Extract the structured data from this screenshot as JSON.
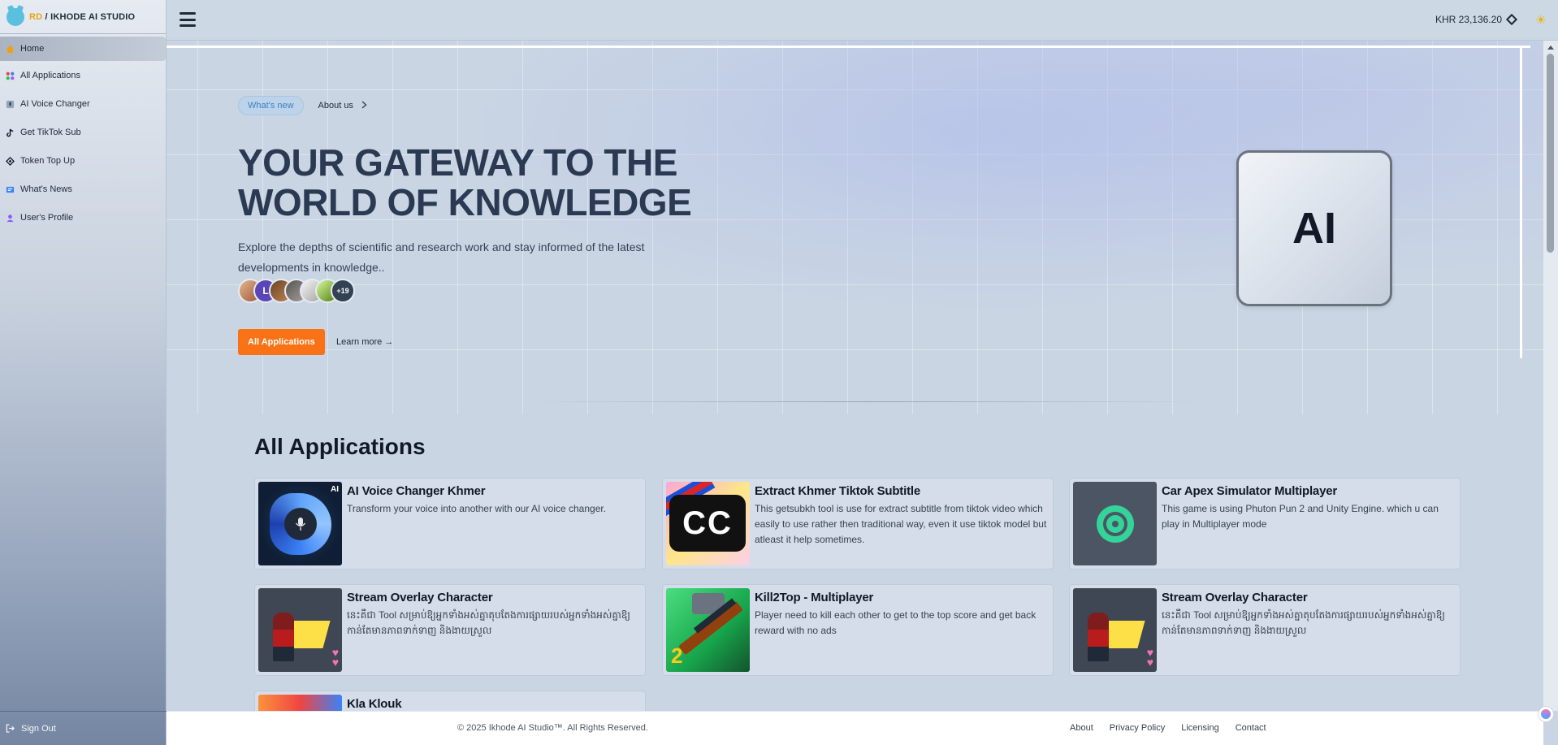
{
  "brand": {
    "prefix": "RD",
    "name": " / IKHODE AI STUDIO"
  },
  "sidebar": {
    "items": [
      {
        "label": "Home",
        "icon": "home-icon"
      },
      {
        "label": "All Applications",
        "icon": "apps-icon"
      },
      {
        "label": "AI Voice Changer",
        "icon": "voice-icon"
      },
      {
        "label": "Get TikTok Sub",
        "icon": "tiktok-icon"
      },
      {
        "label": "Token Top Up",
        "icon": "token-icon"
      },
      {
        "label": "What's News",
        "icon": "news-icon"
      },
      {
        "label": "User's Profile",
        "icon": "profile-icon"
      }
    ],
    "signout": "Sign Out"
  },
  "topbar": {
    "balance": "KHR 23,136.20"
  },
  "hero": {
    "pill": "What's new",
    "about": "About us",
    "title": "YOUR GATEWAY TO THE WORLD OF KNOWLEDGE",
    "subtitle": "Explore the depths of scientific and research work and stay informed of the latest developments in knowledge..",
    "avatar_more": "+19",
    "avatar_letter": "L",
    "cta": "All Applications",
    "learn_more": "Learn more →",
    "ai_badge": "AI"
  },
  "apps": {
    "title": "All Applications",
    "items": [
      {
        "title": "AI Voice Changer Khmer",
        "desc": "Transform your voice into another with our AI voice changer.",
        "thumb_label": "AI"
      },
      {
        "title": "Extract Khmer Tiktok Subtitle",
        "desc": "This getsubkh tool is use for extract subtitle from tiktok video which easily to use rather then traditional way, even it use tiktok model but atleast it help sometimes.",
        "thumb_label": "CC"
      },
      {
        "title": "Car Apex Simulator Multiplayer",
        "desc": "This game is using Phuton Pun 2 and Unity Engine. which u can play in Multiplayer mode"
      },
      {
        "title": "Stream Overlay Character",
        "desc": "នេះគឺជា Tool សម្រាប់ឱ្យអ្នកទាំងអស់គ្នាតុបតែងការផ្សាយរបស់អ្នកទាំងអស់គ្នាឱ្យកាន់តែមានភាពទាក់ទាញ និងងាយស្រួល"
      },
      {
        "title": "Kill2Top - Multiplayer",
        "desc": "Player need to kill each other to get to the top score and get back reward with no ads",
        "thumb_label": "2"
      },
      {
        "title": "Stream Overlay Character",
        "desc": "នេះគឺជា Tool សម្រាប់ឱ្យអ្នកទាំងអស់គ្នាតុបតែងការផ្សាយរបស់អ្នកទាំងអស់គ្នាឱ្យកាន់តែមានភាពទាក់ទាញ និងងាយស្រួល"
      },
      {
        "title": "Kla Klouk",
        "desc": ""
      }
    ]
  },
  "footer": {
    "copyright": "© 2025 Ikhode AI Studio™. All Rights Reserved.",
    "links": [
      "About",
      "Privacy Policy",
      "Licensing",
      "Contact"
    ]
  },
  "colors": {
    "accent": "#f97316",
    "pill": "#3b82c4",
    "sidebar_bottom": "#7486a2"
  }
}
